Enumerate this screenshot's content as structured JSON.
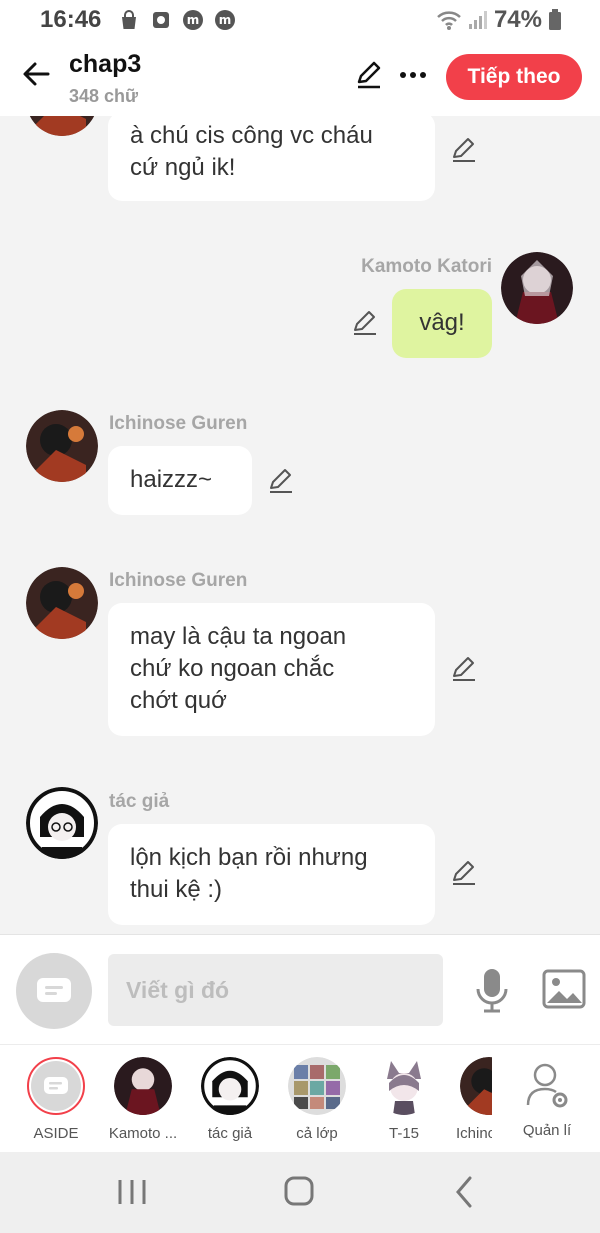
{
  "status_bar": {
    "time": "16:46",
    "battery": "74%"
  },
  "header": {
    "title": "chap3",
    "word_count": "348 chữ",
    "next_label": "Tiếp theo"
  },
  "messages": [
    {
      "sender": "",
      "text_lines": [
        "à chú cis công vc cháu",
        "cứ ngủ ik!"
      ],
      "side": "left",
      "avatar_icon": "ichinose-guren-avatar"
    },
    {
      "sender": "Kamoto Katori",
      "text_lines": [
        "vâg!"
      ],
      "side": "right",
      "avatar_icon": "kamoto-katori-avatar"
    },
    {
      "sender": "Ichinose Guren",
      "text_lines": [
        "haizzz~"
      ],
      "side": "left",
      "avatar_icon": "ichinose-guren-avatar"
    },
    {
      "sender": "Ichinose Guren",
      "text_lines": [
        "may là cậu ta ngoan",
        "chứ ko ngoan chắc",
        "chớt quớ"
      ],
      "side": "left",
      "avatar_icon": "ichinose-guren-avatar"
    },
    {
      "sender": "tác giả",
      "text_lines": [
        "lộn kịch bạn rồi nhưng",
        "thui kệ :)"
      ],
      "side": "left",
      "avatar_icon": "tac-gia-avatar"
    }
  ],
  "input": {
    "placeholder": "Viết gì đó"
  },
  "characters": [
    {
      "label": "ASIDE"
    },
    {
      "label": "Kamoto ..."
    },
    {
      "label": "tác giả"
    },
    {
      "label": "cả lớp"
    },
    {
      "label": "T-15"
    },
    {
      "label": "Ichino"
    },
    {
      "label": "Quản lí"
    }
  ],
  "colors": {
    "accent": "#f2404a",
    "right_bubble": "#dff4a0",
    "background": "#f3f3f3"
  }
}
